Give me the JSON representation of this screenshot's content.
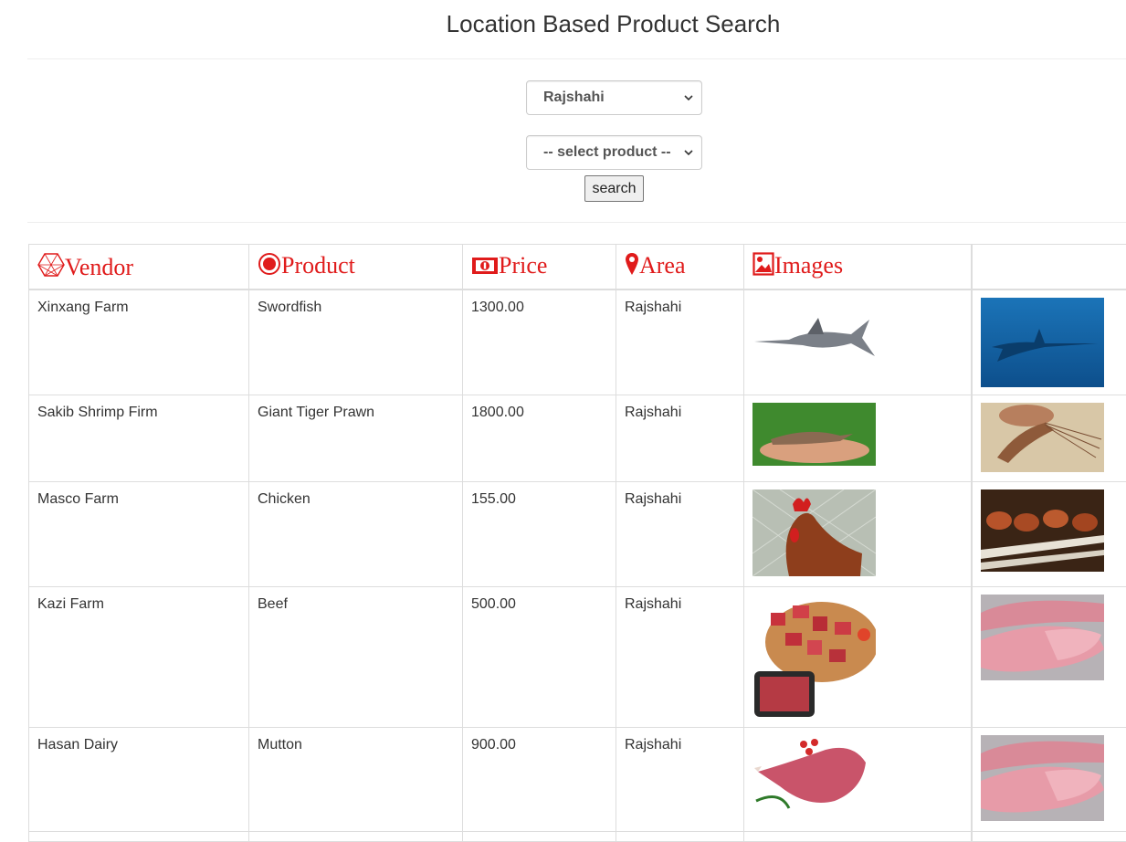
{
  "page": {
    "title": "Location Based Product Search"
  },
  "filters": {
    "city_selected": "Rajshahi",
    "product_selected": "-- select product --",
    "search_label": "search"
  },
  "table": {
    "headers": [
      {
        "label": "Vendor",
        "icon": "vendor-icon"
      },
      {
        "label": "Product",
        "icon": "product-icon"
      },
      {
        "label": "Price",
        "icon": "price-icon"
      },
      {
        "label": "Area",
        "icon": "map-marker-icon"
      },
      {
        "label": "Images",
        "icon": "image-icon"
      }
    ],
    "rows": [
      {
        "vendor": "Xinxang Farm",
        "product": "Swordfish",
        "price": "1300.00",
        "area": "Rajshahi"
      },
      {
        "vendor": "Sakib Shrimp Firm",
        "product": "Giant Tiger Prawn",
        "price": "1800.00",
        "area": "Rajshahi"
      },
      {
        "vendor": "Masco Farm",
        "product": "Chicken",
        "price": "155.00",
        "area": "Rajshahi"
      },
      {
        "vendor": "Kazi Farm",
        "product": "Beef",
        "price": "500.00",
        "area": "Rajshahi"
      },
      {
        "vendor": "Hasan Dairy",
        "product": "Mutton",
        "price": "900.00",
        "area": "Rajshahi"
      }
    ]
  },
  "colors": {
    "header_accent": "#e01b1b",
    "border": "#dddddd",
    "text": "#333333"
  }
}
